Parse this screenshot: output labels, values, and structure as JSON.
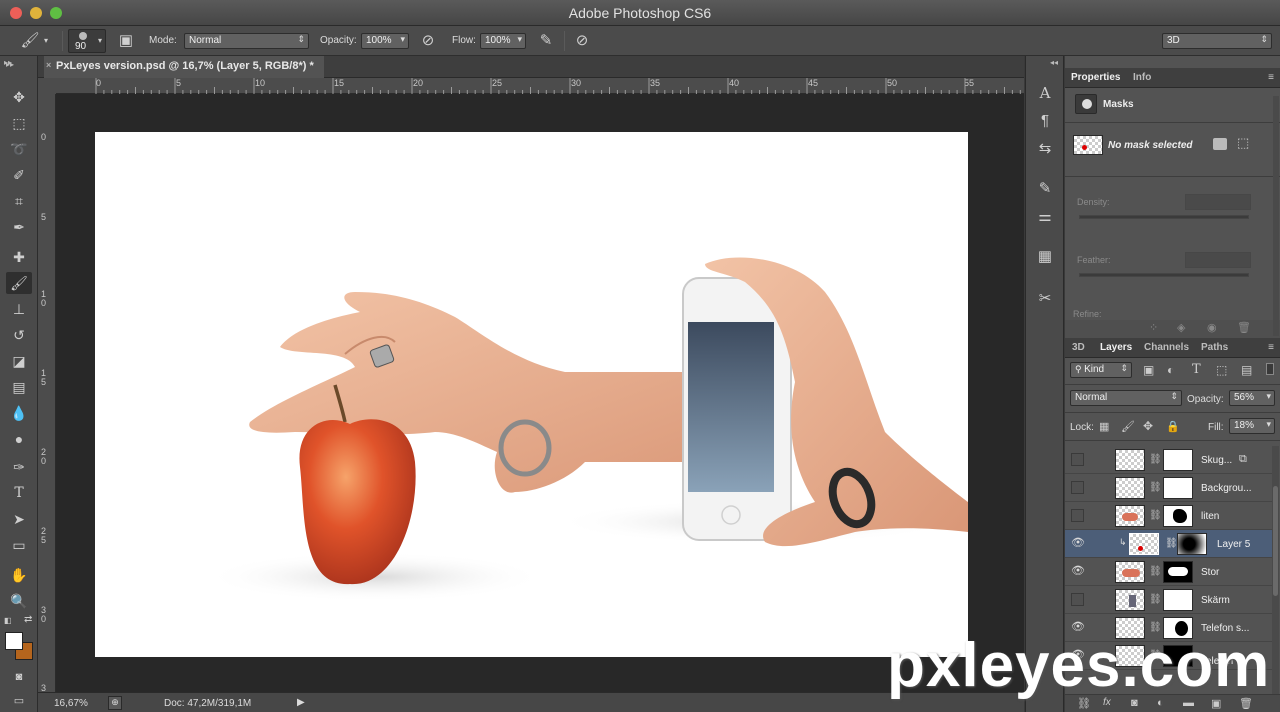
{
  "app": {
    "title": "Adobe Photoshop CS6",
    "window_buttons": {
      "close": "#ec5f58",
      "minimize": "#e0b33b",
      "zoom": "#5fbf43"
    }
  },
  "options_bar": {
    "brush_size": "90",
    "mode_label": "Mode:",
    "mode_value": "Normal",
    "opacity_label": "Opacity:",
    "opacity_value": "100%",
    "flow_label": "Flow:",
    "flow_value": "100%",
    "workspace": "3D"
  },
  "document": {
    "tab_title": "PxLeyes version.psd @ 16,7% (Layer 5, RGB/8*) *",
    "ruler_h": [
      "0",
      "5",
      "10",
      "15",
      "20",
      "25",
      "30",
      "35",
      "40",
      "45",
      "50",
      "55"
    ],
    "ruler_v": [
      "0",
      "5",
      "1 0",
      "1 5",
      "2 0",
      "2 5",
      "3 0",
      "3 5"
    ],
    "zoom": "16,67%",
    "doc_size": "Doc: 47,2M/319,1M"
  },
  "properties_panel": {
    "tabs": [
      "Properties",
      "Info"
    ],
    "section": "Masks",
    "mask_status": "No mask selected",
    "density_label": "Density:",
    "feather_label": "Feather:",
    "refine_label": "Refine:"
  },
  "layers_panel": {
    "tabs": [
      "3D",
      "Layers",
      "Channels",
      "Paths"
    ],
    "filter_kind": "Kind",
    "blend_mode": "Normal",
    "opacity_label": "Opacity:",
    "opacity_value": "56%",
    "lock_label": "Lock:",
    "fill_label": "Fill:",
    "fill_value": "18%",
    "layers": [
      {
        "name": "Skug...",
        "visible": false,
        "selected": false
      },
      {
        "name": "Backgrou...",
        "visible": false,
        "selected": false
      },
      {
        "name": "liten",
        "visible": false,
        "selected": false
      },
      {
        "name": "Layer 5",
        "visible": true,
        "selected": true
      },
      {
        "name": "Stor",
        "visible": true,
        "selected": false
      },
      {
        "name": "Skärm",
        "visible": false,
        "selected": false
      },
      {
        "name": "Telefon s...",
        "visible": true,
        "selected": false
      },
      {
        "name": "Telefon",
        "visible": true,
        "selected": false
      }
    ]
  },
  "watermark": "pxleyes.com",
  "colors": {
    "foreground": "#ffffff",
    "background": "#b5651d",
    "selected_layer": "#4c5e78"
  }
}
